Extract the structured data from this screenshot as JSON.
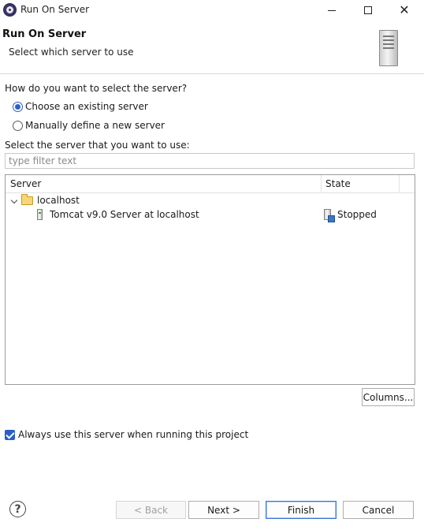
{
  "window": {
    "title": "Run On Server",
    "controls": {
      "minimize": "minimize-icon",
      "maximize": "maximize-icon",
      "close": "close-icon"
    }
  },
  "header": {
    "title": "Run On Server",
    "subtitle": "Select which server to use"
  },
  "selection": {
    "question": "How do you want to select the server?",
    "options": [
      {
        "label": "Choose an existing server",
        "selected": true
      },
      {
        "label": "Manually define a new server",
        "selected": false
      }
    ]
  },
  "server_list": {
    "prompt": "Select the server that you want to use:",
    "filter_placeholder": "type filter text",
    "filter_value": "",
    "columns": [
      "Server",
      "State"
    ],
    "tree": {
      "group": "localhost",
      "expanded": true,
      "servers": [
        {
          "name": "Tomcat v9.0 Server at localhost",
          "state": "Stopped"
        }
      ]
    },
    "columns_button": "Columns..."
  },
  "always_use": {
    "label": "Always use this server when running this project",
    "checked": true
  },
  "footer": {
    "help_glyph": "?",
    "back": "< Back",
    "next": "Next >",
    "finish": "Finish",
    "cancel": "Cancel"
  },
  "colors": {
    "accent": "#2a5ec9",
    "primary_border": "#3b78d8"
  }
}
